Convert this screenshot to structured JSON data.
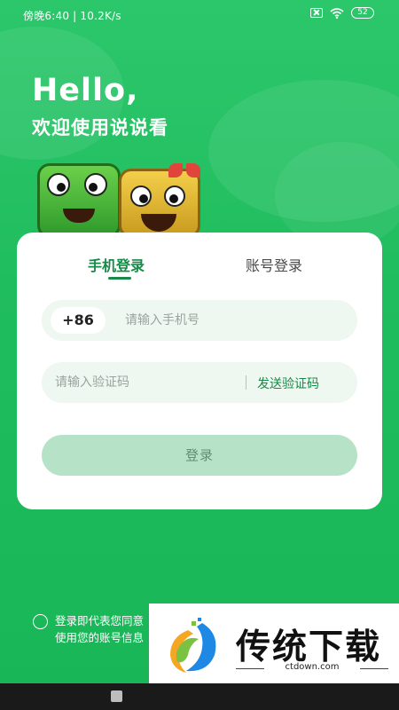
{
  "status_bar": {
    "time_speed": "傍晚6:40 | 10.2K/s",
    "battery": "52",
    "icons": [
      "sim-off-icon",
      "wifi-icon",
      "battery-icon"
    ]
  },
  "header": {
    "greeting": "Hello,",
    "welcome": "欢迎使用说说看"
  },
  "tabs": [
    {
      "label": "手机登录",
      "active": true
    },
    {
      "label": "账号登录",
      "active": false
    }
  ],
  "phone_field": {
    "country_code": "+86",
    "placeholder": "请输入手机号",
    "value": ""
  },
  "code_field": {
    "placeholder": "请输入验证码",
    "value": "",
    "send_label": "发送验证码"
  },
  "login_button": {
    "label": "登录"
  },
  "agreement": {
    "line1": "登录即代表您同意",
    "line2": "使用您的账号信息"
  },
  "watermark": {
    "title": "传统下载",
    "url": "ctdown.com"
  },
  "colors": {
    "brand_green": "#20bd5e",
    "accent_green": "#178a48",
    "field_bg": "#eef7f0",
    "button_disabled": "#b6e3c7"
  }
}
